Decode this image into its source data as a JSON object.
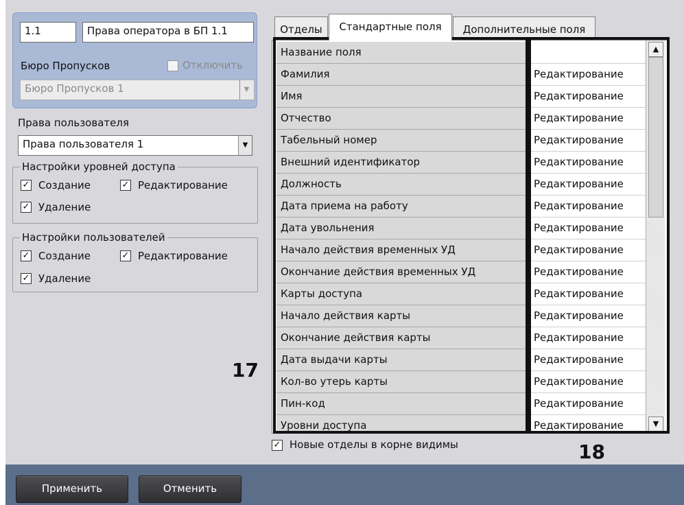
{
  "top_group": {
    "id_value": "1.1",
    "name_value": "Права оператора в БП 1.1",
    "bureau_label": "Бюро Пропусков",
    "disable_label": "Отключить",
    "bureau_select": "Бюро Пропусков 1"
  },
  "user_rights": {
    "label": "Права пользователя",
    "value": "Права пользователя 1"
  },
  "access_levels": {
    "legend": "Настройки уровней доступа",
    "create": "Создание",
    "edit": "Редактирование",
    "delete": "Удаление"
  },
  "user_settings": {
    "legend": "Настройки пользователей",
    "create": "Создание",
    "edit": "Редактирование",
    "delete": "Удаление"
  },
  "tabs": [
    {
      "label": "Отделы"
    },
    {
      "label": "Стандартные поля"
    },
    {
      "label": "Дополнительные поля"
    }
  ],
  "grid": {
    "header": "Название поля",
    "rows": [
      {
        "name": "Фамилия",
        "value": "Редактирование"
      },
      {
        "name": "Имя",
        "value": "Редактирование"
      },
      {
        "name": "Отчество",
        "value": "Редактирование"
      },
      {
        "name": "Табельный номер",
        "value": "Редактирование"
      },
      {
        "name": "Внешний идентификатор",
        "value": "Редактирование"
      },
      {
        "name": "Должность",
        "value": "Редактирование"
      },
      {
        "name": "Дата приема на работу",
        "value": "Редактирование"
      },
      {
        "name": "Дата увольнения",
        "value": "Редактирование"
      },
      {
        "name": "Начало действия временных УД",
        "value": "Редактирование"
      },
      {
        "name": "Окончание действия временных УД",
        "value": "Редактирование"
      },
      {
        "name": "Карты доступа",
        "value": "Редактирование"
      },
      {
        "name": "Начало действия карты",
        "value": "Редактирование"
      },
      {
        "name": "Окончание действия карты",
        "value": "Редактирование"
      },
      {
        "name": "Дата выдачи карты",
        "value": "Редактирование"
      },
      {
        "name": "Кол-во утерь карты",
        "value": "Редактирование"
      },
      {
        "name": "Пин-код",
        "value": "Редактирование"
      },
      {
        "name": "Уровни доступа",
        "value": "Редактирование"
      }
    ]
  },
  "new_depts_visible": "Новые отделы в корне видимы",
  "annotations": {
    "left": "17",
    "right": "18"
  },
  "buttons": {
    "apply": "Применить",
    "cancel": "Отменить"
  }
}
